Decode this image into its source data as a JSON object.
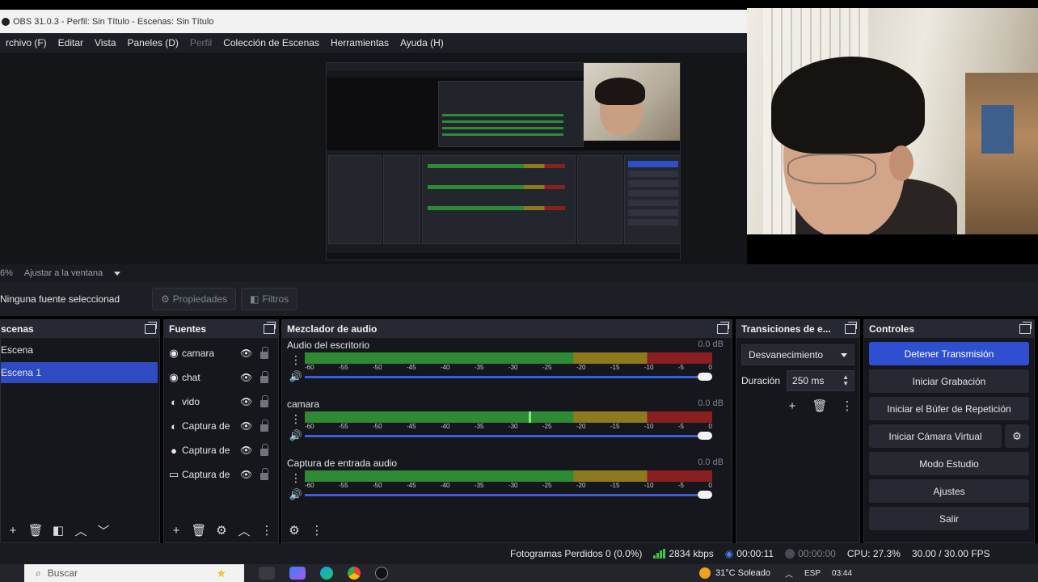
{
  "window": {
    "title": "OBS 31.0.3 - Perfil: Sin Título - Escenas: Sin Título"
  },
  "menu": [
    "rchivo (F)",
    "Editar",
    "Vista",
    "Paneles (D)",
    "Perfil",
    "Colección de Escenas",
    "Herramientas",
    "Ayuda (H)"
  ],
  "preview": {
    "zoom": "6%",
    "fit_label": "Ajustar a la ventana"
  },
  "properties_bar": {
    "no_selection": "Ninguna fuente seleccionad",
    "properties": "Propiedades",
    "filters": "Filtros"
  },
  "scenes": {
    "title": "scenas",
    "items": [
      "Escena",
      "Escena 1"
    ],
    "active_index": 1
  },
  "sources": {
    "title": "Fuentes",
    "items": [
      {
        "icon": "camera-icon",
        "name": "camara"
      },
      {
        "icon": "chat-icon",
        "name": "chat"
      },
      {
        "icon": "video-icon",
        "name": "vido"
      },
      {
        "icon": "capture-icon",
        "name": "Captura de"
      },
      {
        "icon": "mic-icon",
        "name": "Captura de"
      },
      {
        "icon": "display-icon",
        "name": "Captura de"
      }
    ]
  },
  "mixer": {
    "title": "Mezclador de audio",
    "channels": [
      {
        "name": "Audio del escritorio",
        "db": "0.0 dB",
        "peak": 0
      },
      {
        "name": "camara",
        "db": "0.0 dB",
        "peak": 0.55
      },
      {
        "name": "Captura de entrada audio",
        "db": "0.0 dB",
        "peak": 0
      }
    ],
    "ticks": [
      "-60",
      "-55",
      "-50",
      "-45",
      "-40",
      "-35",
      "-30",
      "-25",
      "-20",
      "-15",
      "-10",
      "-5",
      "0"
    ]
  },
  "transitions": {
    "title": "Transiciones de e...",
    "selected": "Desvanecimiento",
    "duration_label": "Duración",
    "duration_value": "250 ms"
  },
  "controls": {
    "title": "Controles",
    "stop_stream": "Detener Transmisión",
    "start_recording": "Iniciar Grabación",
    "replay_buffer": "Iniciar el Búfer de Repetición",
    "virtual_camera": "Iniciar Cámara Virtual",
    "studio_mode": "Modo Estudio",
    "settings": "Ajustes",
    "exit": "Salir"
  },
  "status": {
    "dropped_frames": "Fotogramas Perdidos 0 (0.0%)",
    "bitrate": "2834 kbps",
    "stream_time": "00:00:11",
    "record_time": "00:00:00",
    "cpu": "CPU: 27.3%",
    "fps": "30.00 / 30.00 FPS"
  },
  "taskbar": {
    "search_placeholder": "Buscar",
    "weather": "31°C  Soleado",
    "lang": "ESP",
    "time": "03:44"
  },
  "colors": {
    "accent": "#2f4fd0",
    "meter_green": "#2e8a35",
    "meter_yellow": "#8e7a1e",
    "meter_red": "#8a1f21"
  }
}
